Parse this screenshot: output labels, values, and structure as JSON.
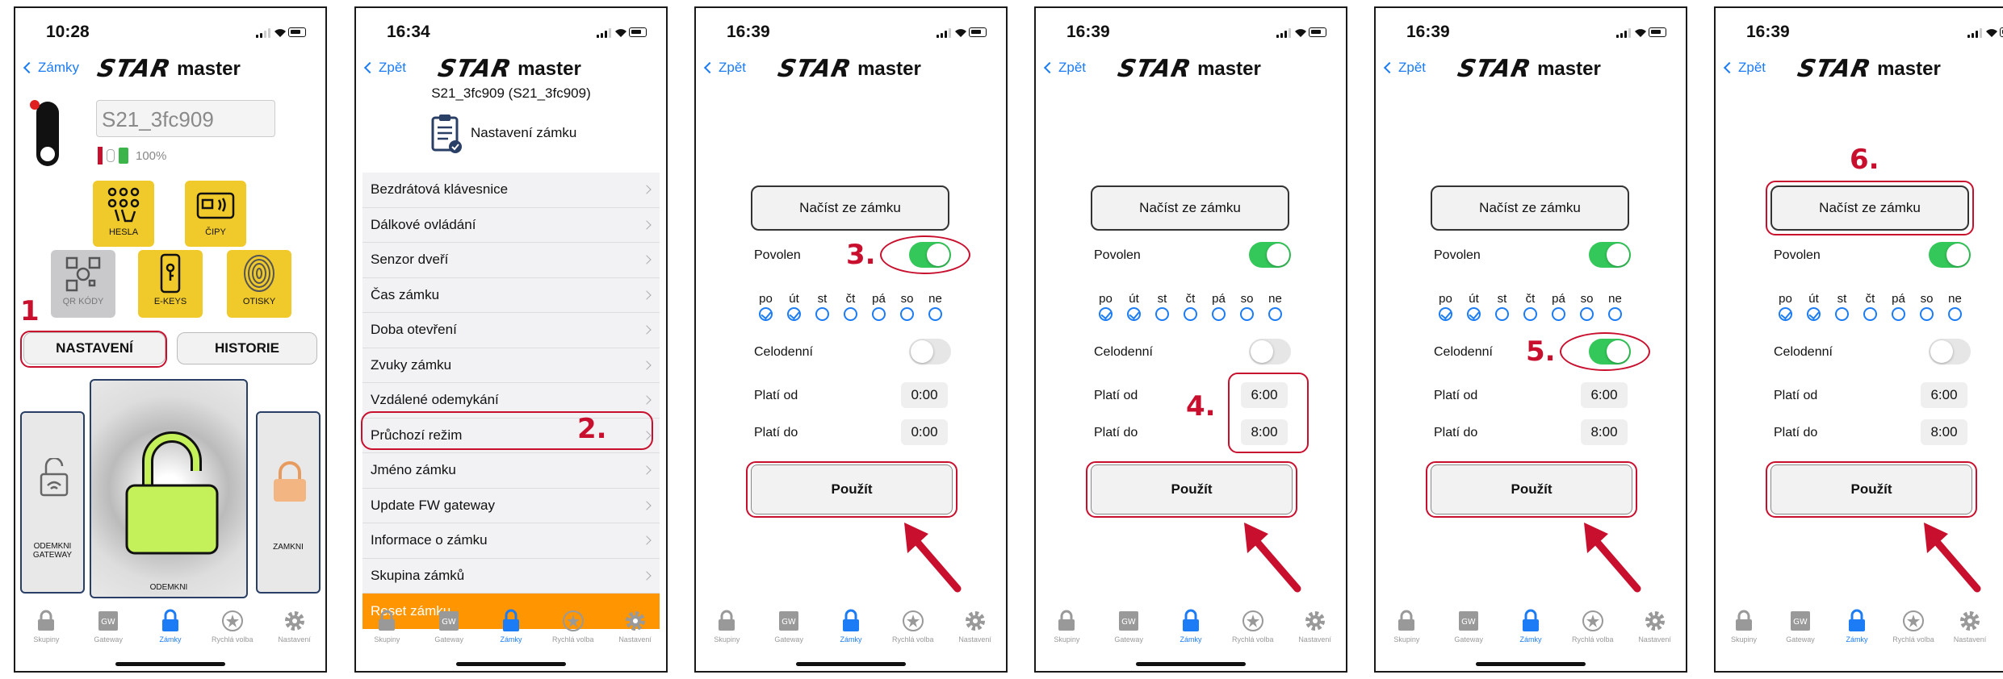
{
  "colors": {
    "accent": "#1b7cf5",
    "toggle_on": "#34c759",
    "highlight": "#c8102e",
    "tile_yellow": "#f0c92a",
    "reset_orange": "#ff9500"
  },
  "brand": {
    "logo_main": "STAR",
    "logo_sub": "master"
  },
  "tabbar": [
    {
      "label": "Skupiny",
      "icon": "lock-group-icon"
    },
    {
      "label": "Gateway",
      "icon": "gateway-icon"
    },
    {
      "label": "Zámky",
      "icon": "lock-icon"
    },
    {
      "label": "Rychlá volba",
      "icon": "star-quick-icon"
    },
    {
      "label": "Nastavení",
      "icon": "gear-icon"
    }
  ],
  "phone1": {
    "time": "10:28",
    "back": "Zámky",
    "lock_name": "S21_3fc909",
    "battery": "100%",
    "tiles": [
      "HESLA",
      "ČIPY",
      "QR KÓDY",
      "E-KEYS",
      "OTISKY"
    ],
    "buttons": {
      "settings": "NASTAVENÍ",
      "history": "HISTORIE"
    },
    "panels": {
      "left": "ODEMKNI GATEWAY",
      "center": "ODEMKNI",
      "right": "ZAMKNI"
    },
    "step": "1"
  },
  "phone2": {
    "time": "16:34",
    "back": "Zpět",
    "subtitle": "S21_3fc909 (S21_3fc909)",
    "section": "Nastavení zámku",
    "menu": [
      "Bezdrátová klávesnice",
      "Dálkové ovládání",
      "Senzor dveří",
      "Čas zámku",
      "Doba otevření",
      "Zvuky zámku",
      "Vzdálené odemykání",
      "Průchozí režim",
      "Jméno zámku",
      "Update FW gateway",
      "Informace o zámku",
      "Skupina zámků"
    ],
    "reset": "Reset zámku",
    "step": "2."
  },
  "settings_screen": {
    "load": "Načíst ze zámku",
    "enabled": "Povolen",
    "days": [
      "po",
      "út",
      "st",
      "čt",
      "pá",
      "so",
      "ne"
    ],
    "all_day": "Celodenní",
    "from": "Platí od",
    "to": "Platí do",
    "apply": "Použít"
  },
  "phone3": {
    "time": "16:39",
    "back": "Zpět",
    "from_val": "0:00",
    "to_val": "0:00",
    "step": "3."
  },
  "phone4": {
    "time": "16:39",
    "back": "Zpět",
    "from_val": "6:00",
    "to_val": "8:00",
    "step": "4."
  },
  "phone5": {
    "time": "16:39",
    "back": "Zpět",
    "from_val": "6:00",
    "to_val": "8:00",
    "step": "5."
  },
  "phone6": {
    "time": "16:39",
    "back": "Zpět",
    "from_val": "6:00",
    "to_val": "8:00",
    "step": "6."
  }
}
